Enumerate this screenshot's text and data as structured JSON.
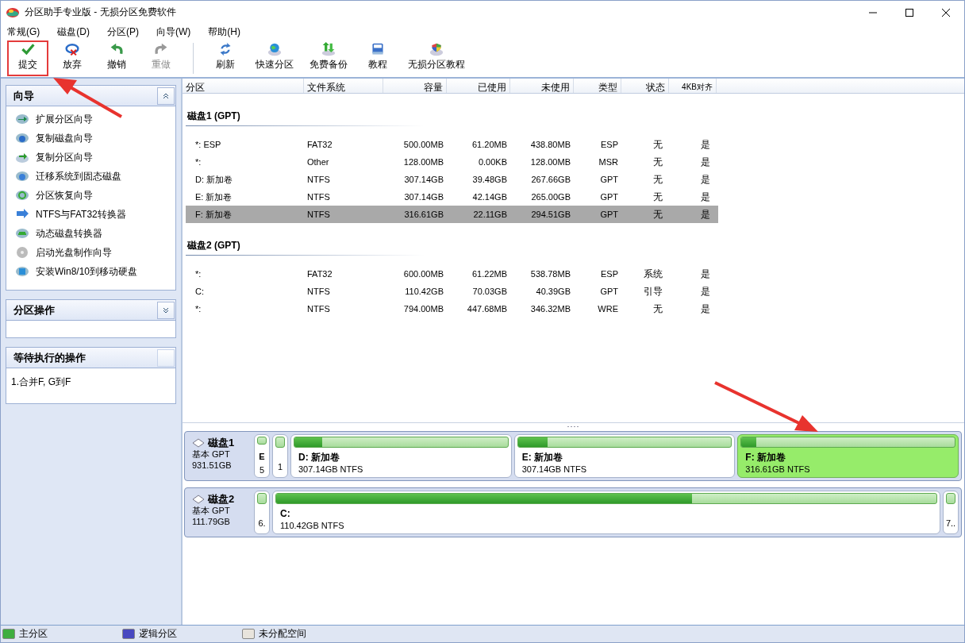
{
  "window": {
    "title": "分区助手专业版 - 无损分区免费软件"
  },
  "menu": [
    "常规(G)",
    "磁盘(D)",
    "分区(P)",
    "向导(W)",
    "帮助(H)"
  ],
  "toolbar": [
    {
      "label": "提交",
      "disabled": false,
      "highlighted": true
    },
    {
      "label": "放弃",
      "disabled": false,
      "highlighted": false
    },
    {
      "label": "撤销",
      "disabled": false,
      "highlighted": false
    },
    {
      "label": "重做",
      "disabled": true,
      "highlighted": false
    },
    {
      "label": "刷新",
      "disabled": false,
      "highlighted": false
    },
    {
      "label": "快速分区",
      "disabled": false,
      "highlighted": false
    },
    {
      "label": "免费备份",
      "disabled": false,
      "highlighted": false
    },
    {
      "label": "教程",
      "disabled": false,
      "highlighted": false
    },
    {
      "label": "无损分区教程",
      "disabled": false,
      "highlighted": false
    }
  ],
  "sidebar": [
    {
      "title": "向导",
      "expanded": true,
      "items": [
        "扩展分区向导",
        "复制磁盘向导",
        "复制分区向导",
        "迁移系统到固态磁盘",
        "分区恢复向导",
        "NTFS与FAT32转换器",
        "动态磁盘转换器",
        "启动光盘制作向导",
        "安装Win8/10到移动硬盘"
      ]
    },
    {
      "title": "分区操作",
      "expanded": false
    },
    {
      "title": "等待执行的操作",
      "items": [
        "1.合并F, G到F"
      ]
    }
  ],
  "table": {
    "columns": [
      "分区",
      "文件系统",
      "容量",
      "已使用",
      "未使用",
      "类型",
      "状态",
      "4KB对齐"
    ],
    "groups": [
      {
        "title": "磁盘1 (GPT)",
        "rows": [
          {
            "cells": [
              "*: ESP",
              "FAT32",
              "500.00MB",
              "61.20MB",
              "438.80MB",
              "ESP",
              "无",
              "是"
            ],
            "selected": false
          },
          {
            "cells": [
              "*:",
              "Other",
              "128.00MB",
              "0.00KB",
              "128.00MB",
              "MSR",
              "无",
              "是"
            ],
            "selected": false
          },
          {
            "cells": [
              "D: 新加卷",
              "NTFS",
              "307.14GB",
              "39.48GB",
              "267.66GB",
              "GPT",
              "无",
              "是"
            ],
            "selected": false
          },
          {
            "cells": [
              "E: 新加卷",
              "NTFS",
              "307.14GB",
              "42.14GB",
              "265.00GB",
              "GPT",
              "无",
              "是"
            ],
            "selected": false
          },
          {
            "cells": [
              "F: 新加卷",
              "NTFS",
              "316.61GB",
              "22.11GB",
              "294.51GB",
              "GPT",
              "无",
              "是"
            ],
            "selected": true
          }
        ]
      },
      {
        "title": "磁盘2 (GPT)",
        "rows": [
          {
            "cells": [
              "*:",
              "FAT32",
              "600.00MB",
              "61.22MB",
              "538.78MB",
              "ESP",
              "系统",
              "是"
            ],
            "selected": false
          },
          {
            "cells": [
              "C:",
              "NTFS",
              "110.42GB",
              "70.03GB",
              "40.39GB",
              "GPT",
              "引导",
              "是"
            ],
            "selected": false
          },
          {
            "cells": [
              "*:",
              "NTFS",
              "794.00MB",
              "447.68MB",
              "346.32MB",
              "WRE",
              "无",
              "是"
            ],
            "selected": false
          }
        ]
      }
    ]
  },
  "disks": [
    {
      "name": "磁盘1",
      "type": "基本 GPT",
      "size": "931.51GB",
      "partitions": [
        {
          "kind": "small",
          "name": "E",
          "info": "5",
          "selected": false
        },
        {
          "kind": "small",
          "info": "1",
          "selected": false
        },
        {
          "kind": "large",
          "name": "D: 新加卷",
          "info": "307.14GB NTFS",
          "level": 0.13,
          "selected": false
        },
        {
          "kind": "large",
          "name": "E: 新加卷",
          "info": "307.14GB NTFS",
          "level": 0.14,
          "selected": false
        },
        {
          "kind": "large",
          "name": "F: 新加卷",
          "info": "316.61GB NTFS",
          "level": 0.07,
          "selected": true
        }
      ]
    },
    {
      "name": "磁盘2",
      "type": "基本 GPT",
      "size": "111.79GB",
      "partitions": [
        {
          "kind": "small",
          "info": "6.",
          "selected": false
        },
        {
          "kind": "wide",
          "name": "C:",
          "info": "110.42GB NTFS",
          "level": 0.63,
          "selected": false
        },
        {
          "kind": "small",
          "info": "7..",
          "selected": false
        }
      ]
    }
  ],
  "legend": [
    {
      "label": "主分区",
      "color": "#3fae3f"
    },
    {
      "label": "逻辑分区",
      "color": "#4848c0"
    },
    {
      "label": "未分配空间",
      "color": "#e8e4dc"
    }
  ]
}
